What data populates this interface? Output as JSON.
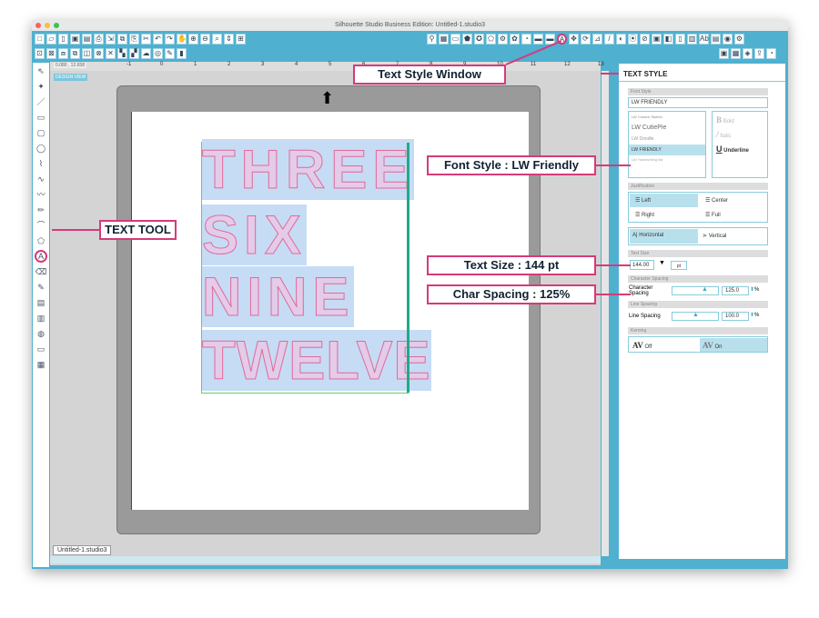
{
  "window": {
    "title": "Silhouette Studio Business Edition: Untitled-1.studio3",
    "document_tab": "Untitled-1.studio3"
  },
  "ruler": {
    "coords": "0.080 , 12.658",
    "ticks": [
      "-1",
      "0",
      "1",
      "2",
      "3",
      "4",
      "5",
      "6",
      "7",
      "8",
      "9",
      "10",
      "11",
      "12",
      "13"
    ],
    "view_label": "DESIGN VIEW"
  },
  "canvas": {
    "lines": [
      "THREE",
      "SIX",
      "NINE",
      "TWELVE"
    ]
  },
  "panel": {
    "title": "TEXT STYLE",
    "font_style_label": "Font Style",
    "font_value": "LW FRIENDLY",
    "fonts": [
      "LW Cursive Sketch",
      "LW CutiePie",
      "LW Doodle",
      "LW FRIENDLY",
      "LW Handwriting Ital"
    ],
    "selected_font": "LW FRIENDLY",
    "style_options": [
      "Bold",
      "Italic",
      "Underline"
    ],
    "justification_label": "Justification",
    "justification": [
      "Left",
      "Center",
      "Right",
      "Full"
    ],
    "selected_justification": "Left",
    "orientation": [
      "Horizontal",
      "Vertical"
    ],
    "selected_orientation": "Horizontal",
    "text_size_label": "Text Size",
    "text_size": "144.00",
    "text_size_unit": "pt",
    "char_spacing_section": "Character Spacing",
    "char_spacing_label": "Character Spacing",
    "char_spacing": "125.0",
    "line_spacing_section": "Line Spacing",
    "line_spacing_label": "Line Spacing",
    "line_spacing": "100.0",
    "percent": "%",
    "kerning_label": "Kerning",
    "kerning": [
      "Off",
      "On"
    ],
    "selected_kerning": "On"
  },
  "annotations": {
    "text_style_window": "Text Style Window",
    "text_tool": "TEXT TOOL",
    "font_style": "Font Style : LW Friendly",
    "text_size": "Text Size : 144 pt",
    "char_spacing": "Char Spacing : 125%"
  },
  "colors": {
    "accent": "#4fb0cf",
    "callout": "#d63a7a",
    "selection": "#b8e0ec"
  }
}
